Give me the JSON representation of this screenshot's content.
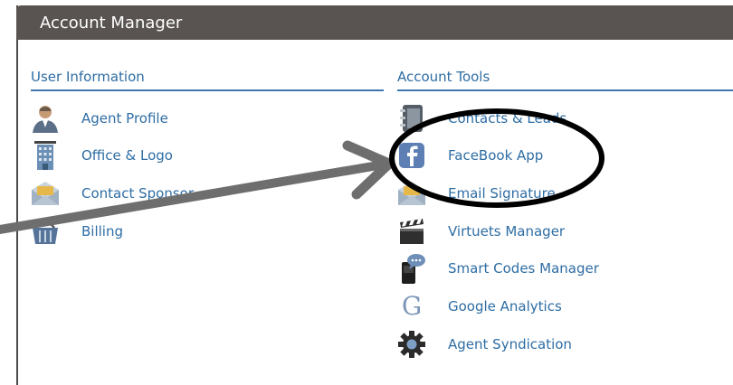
{
  "header": {
    "title": "Account Manager"
  },
  "user_information": {
    "heading": "User Information",
    "items": [
      {
        "label": "Agent Profile",
        "icon": "person-icon"
      },
      {
        "label": "Office & Logo",
        "icon": "building-icon"
      },
      {
        "label": "Contact Sponsor",
        "icon": "envelope-icon"
      },
      {
        "label": "Billing",
        "icon": "basket-icon"
      }
    ]
  },
  "account_tools": {
    "heading": "Account Tools",
    "items": [
      {
        "label": "Contacts & Leads",
        "icon": "notebook-icon"
      },
      {
        "label": "FaceBook App",
        "icon": "facebook-icon"
      },
      {
        "label": "Email Signature",
        "icon": "envelope-icon"
      },
      {
        "label": "Virtuets Manager",
        "icon": "clapperboard-icon"
      },
      {
        "label": "Smart Codes Manager",
        "icon": "phone-chat-icon"
      },
      {
        "label": "Google Analytics",
        "icon": "google-g-icon"
      },
      {
        "label": "Agent Syndication",
        "icon": "gear-icon"
      }
    ]
  },
  "colors": {
    "header_bg": "#595451",
    "link": "#2e6da4",
    "annotation_arrow": "#6e6e6e",
    "annotation_circle": "#000000"
  }
}
